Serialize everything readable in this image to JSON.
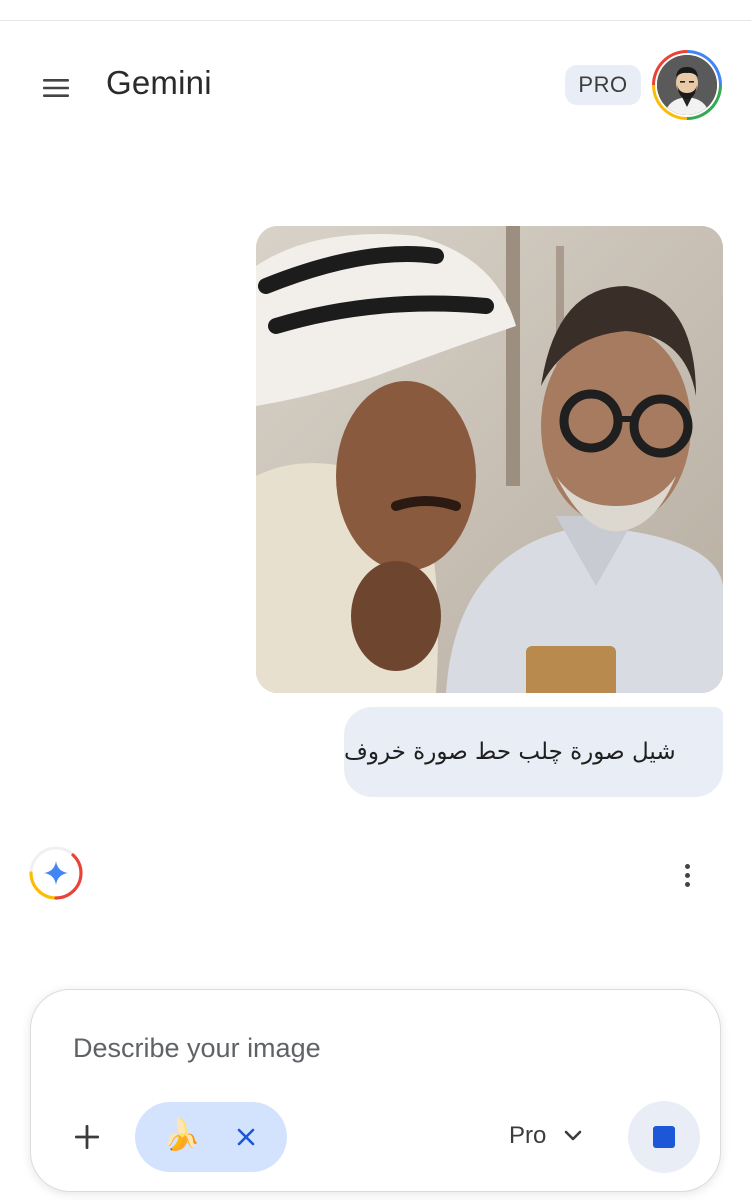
{
  "header": {
    "title": "Gemini",
    "plan_badge": "PRO",
    "menu_icon": "menu-icon",
    "avatar_icon": "user-avatar"
  },
  "conversation": {
    "shared_image": "photo-of-two-men",
    "user_message": "شيل صورة چلب حط صورة خروف",
    "assistant_icon": "gemini-spark-loading-icon",
    "more_icon": "more-vert-icon"
  },
  "composer": {
    "placeholder": "Describe your image",
    "value": "",
    "add_icon": "plus-icon",
    "tool_chip_emoji": "🍌",
    "tool_chip_close_icon": "close-icon",
    "model_label": "Pro",
    "model_dropdown_icon": "chevron-down-icon",
    "stop_icon": "stop-icon"
  },
  "colors": {
    "accent_blue": "#1b57d6",
    "bubble_bg": "#e9eef6",
    "chip_bg": "#d3e3fd",
    "google_blue": "#4285f4",
    "google_green": "#34a853",
    "google_yellow": "#fbbc04",
    "google_red": "#ea4335"
  }
}
